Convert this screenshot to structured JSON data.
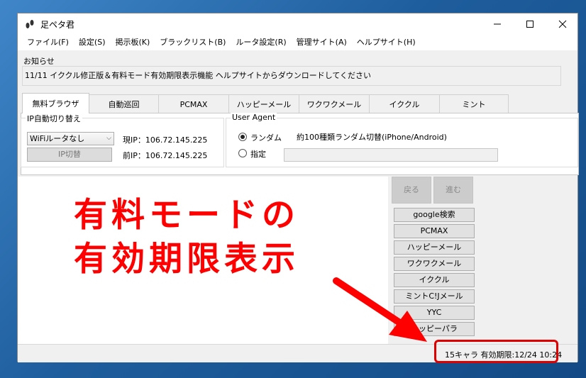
{
  "window": {
    "title": "足ペタ君"
  },
  "menu": [
    "ファイル(F)",
    "設定(S)",
    "掲示板(K)",
    "ブラックリスト(B)",
    "ルータ設定(R)",
    "管理サイト(A)",
    "ヘルプサイト(H)"
  ],
  "notice": {
    "label": "お知らせ",
    "text": "11/11  イククル修正版＆有料モード有効期限表示機能  ヘルプサイトからダウンロードしてください"
  },
  "tabs": [
    "無料ブラウザ",
    "自動巡回",
    "PCMAX",
    "ハッピーメール",
    "ワクワクメール",
    "イククル",
    "ミント"
  ],
  "ip_group": {
    "title": "IP自動切り替え",
    "select_value": "WiFiルータなし",
    "button": "IP切替",
    "current_ip": "現IP：106.72.145.225",
    "previous_ip": "前IP：106.72.145.225"
  },
  "ua_group": {
    "title": "User Agent",
    "radio_random": "ランダム",
    "random_desc": "約100種類ランダム切替(iPhone/Android)",
    "radio_specify": "指定",
    "specify_value": ""
  },
  "nav": {
    "back": "戻る",
    "forward": "進む"
  },
  "sites": [
    "google検索",
    "PCMAX",
    "ハッピーメール",
    "ワクワクメール",
    "イククル",
    "ミントC!Jメール",
    "YYC",
    "ハッピーパラ"
  ],
  "status": {
    "text": "15キャラ 有効期限:12/24 10:24"
  },
  "overlay": {
    "line1": "有料モードの",
    "line2": "有効期限表示"
  },
  "colors": {
    "annotation": "#e00000",
    "overlay_text": "#ff0000"
  }
}
